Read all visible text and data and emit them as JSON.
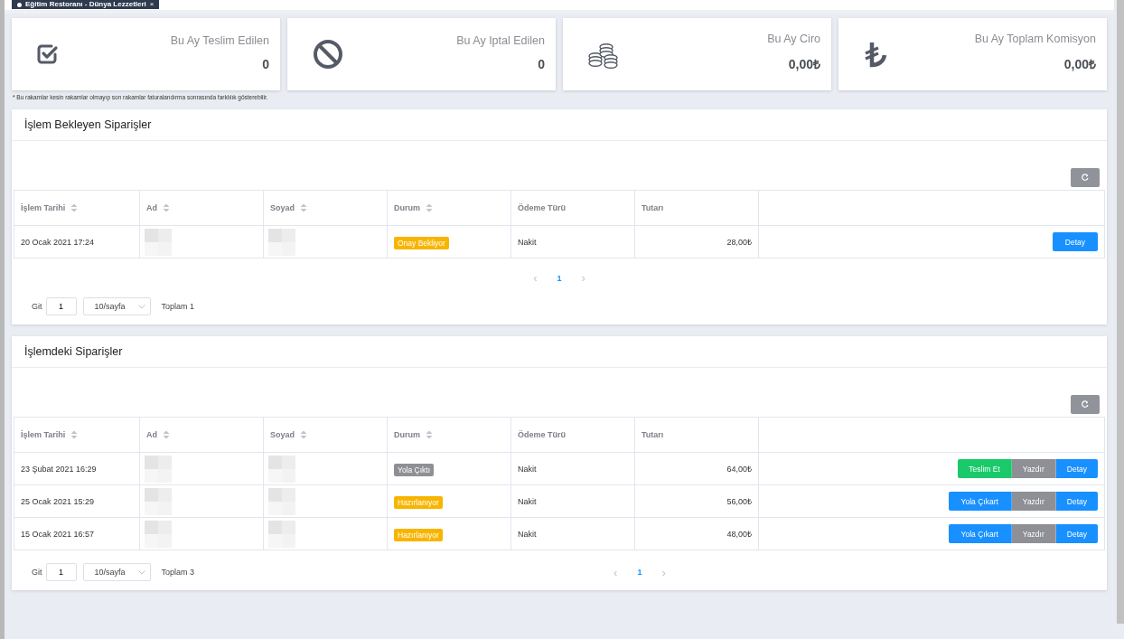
{
  "top_tab": {
    "label": "Eğitim Restoranı - Dünya Lezzetleri",
    "close": "×"
  },
  "stats": [
    {
      "title": "Bu Ay Teslim Edilen",
      "value": "0"
    },
    {
      "title": "Bu Ay Iptal Edilen",
      "value": "0"
    },
    {
      "title": "Bu Ay Ciro",
      "value": "0,00₺"
    },
    {
      "title": "Bu Ay Toplam Komisyon",
      "value": "0,00₺"
    }
  ],
  "note": "* Bu rakamlar kesin rakamlar olmayıp son rakamlar faturalandırma sonrasında farklılık gösterebilir.",
  "panels": [
    {
      "title": "İşlem Bekleyen Siparişler",
      "kind": "stacked",
      "columns": [
        {
          "label": "İşlem Tarihi",
          "sortable": true
        },
        {
          "label": "Ad",
          "sortable": true
        },
        {
          "label": "Soyad",
          "sortable": true
        },
        {
          "label": "Durum",
          "sortable": true
        },
        {
          "label": "Ödeme Türü",
          "sortable": false
        },
        {
          "label": "Tutarı",
          "sortable": false
        }
      ],
      "rows": [
        {
          "date": "20 Ocak 2021 17:24",
          "status": {
            "label": "Onay Bekliyor",
            "kind": "warning"
          },
          "payment": "Nakit",
          "amount": "28,00₺",
          "actions": [
            {
              "label": "Detay",
              "kind": "primary"
            }
          ]
        }
      ],
      "pager": {
        "prev": "‹",
        "pages": [
          {
            "label": "1",
            "selected": true
          }
        ],
        "next": "›",
        "goto_label": "Git",
        "goto_value": "1",
        "page_size": "10/sayfa",
        "total": "Toplam 1"
      }
    },
    {
      "title": "İşlemdeki Siparişler",
      "kind": "inline",
      "columns": [
        {
          "label": "İşlem Tarihi",
          "sortable": true
        },
        {
          "label": "Ad",
          "sortable": true
        },
        {
          "label": "Soyad",
          "sortable": true
        },
        {
          "label": "Durum",
          "sortable": true
        },
        {
          "label": "Ödeme Türü",
          "sortable": false
        },
        {
          "label": "Tutarı",
          "sortable": false
        }
      ],
      "rows": [
        {
          "date": "23 Şubat 2021 16:29",
          "status": {
            "label": "Yola Çıktı",
            "kind": "default"
          },
          "payment": "Nakit",
          "amount": "64,00₺",
          "actions": [
            {
              "label": "Teslim Et",
              "kind": "success"
            },
            {
              "label": "Yazdır",
              "kind": "secondary"
            },
            {
              "label": "Detay",
              "kind": "primary"
            }
          ]
        },
        {
          "date": "25 Ocak 2021 15:29",
          "status": {
            "label": "Hazırlanıyor",
            "kind": "warning"
          },
          "payment": "Nakit",
          "amount": "56,00₺",
          "actions": [
            {
              "label": "Yola Çıkart",
              "kind": "primary"
            },
            {
              "label": "Yazdır",
              "kind": "secondary"
            },
            {
              "label": "Detay",
              "kind": "primary"
            }
          ]
        },
        {
          "date": "15 Ocak 2021 16:57",
          "status": {
            "label": "Hazırlanıyor",
            "kind": "warning"
          },
          "payment": "Nakit",
          "amount": "48,00₺",
          "actions": [
            {
              "label": "Yola Çıkart",
              "kind": "primary"
            },
            {
              "label": "Yazdır",
              "kind": "secondary"
            },
            {
              "label": "Detay",
              "kind": "primary"
            }
          ]
        }
      ],
      "pager": {
        "prev": "‹",
        "pages": [
          {
            "label": "1",
            "selected": true
          }
        ],
        "next": "›",
        "goto_label": "Git",
        "goto_value": "1",
        "page_size": "10/sayfa",
        "total": "Toplam 3"
      }
    }
  ]
}
